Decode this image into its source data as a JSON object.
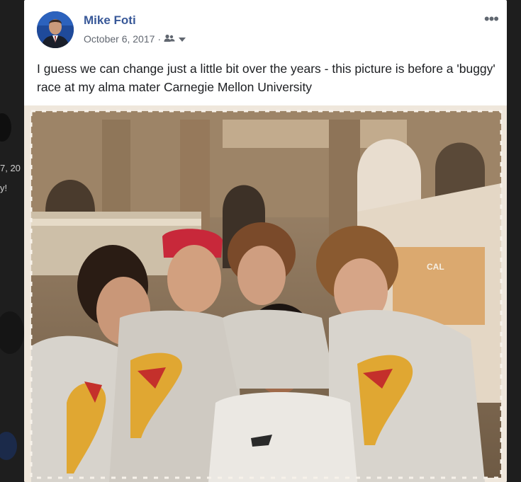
{
  "post": {
    "author_name": "Mike Foti",
    "date": "October 6, 2017",
    "separator": "·",
    "audience_icon": "friends-icon",
    "dropdown_icon": "caret-down-icon",
    "more_icon": "more-horizontal-icon",
    "more_label": "•••",
    "text": "I guess we can change just a little bit over the years - this picture is before a 'buggy' race at my alma mater Carnegie Mellon University"
  },
  "photo": {
    "description_icon": "photo-image",
    "shirt_text": "CAL"
  },
  "background": {
    "peek_year": "7, 20",
    "peek_word": "y!"
  },
  "colors": {
    "author_link": "#385898",
    "meta_gray": "#616770",
    "text": "#1c1e21",
    "card_bg": "#ffffff"
  }
}
